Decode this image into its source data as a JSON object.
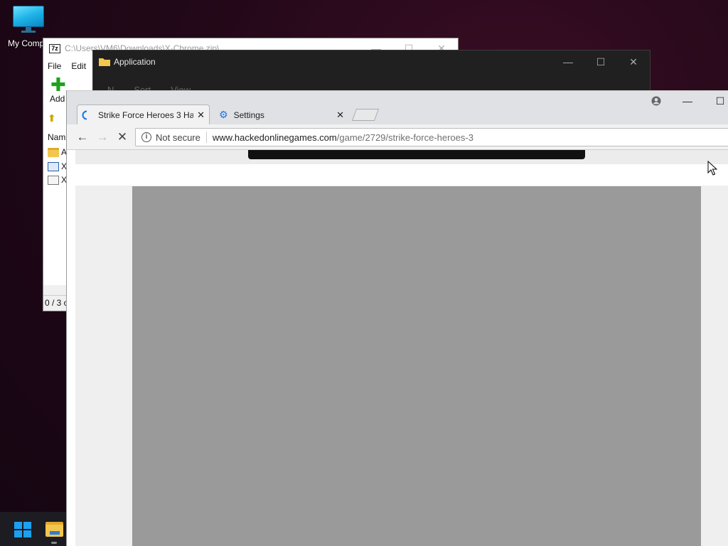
{
  "desktop": {
    "my_computer_label": "My Compu"
  },
  "sevenzip": {
    "logo_text": "7z",
    "title": "C:\\Users\\VM6\\Downloads\\X-Chrome.zip\\",
    "menu": [
      "File",
      "Edit"
    ],
    "add_label": "Add",
    "name_column": "Nam",
    "rows": [
      {
        "icon": "folder-icon",
        "label": "A"
      },
      {
        "icon": "zip-file-icon",
        "label": "X-"
      },
      {
        "icon": "text-file-icon",
        "label": "X-"
      }
    ],
    "status": "0 / 3 o"
  },
  "explorer": {
    "title": "Application",
    "ribbon": [
      "N",
      "Sort",
      "View"
    ]
  },
  "chrome": {
    "tabs": [
      {
        "label": "Strike Force Heroes 3 Hac",
        "icon": "loading-spinner-icon"
      },
      {
        "label": "Settings",
        "icon": "gear-icon"
      }
    ],
    "omnibox": {
      "security": "Not secure",
      "host": "www.hackedonlinegames.com",
      "path": "/game/2729/strike-force-heroes-3"
    }
  },
  "colors": {
    "accent": "#1a73e8",
    "start": "#1aa1f2",
    "game_frame": "#9a9a9a"
  }
}
